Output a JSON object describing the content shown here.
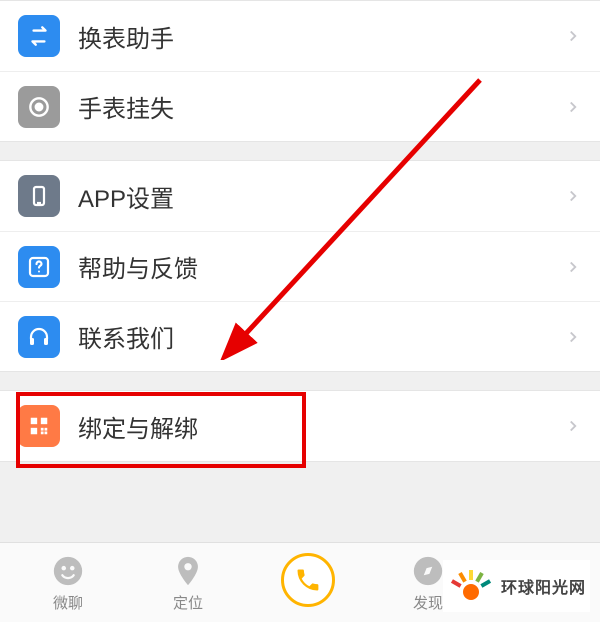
{
  "groups": [
    {
      "items": [
        {
          "name": "row-change-watch",
          "icon_name": "swap-icon",
          "icon_bg": "#2d8cf0",
          "label": "换表助手"
        },
        {
          "name": "row-watch-lost",
          "icon_name": "target-icon",
          "icon_bg": "#9b9b9b",
          "label": "手表挂失"
        }
      ]
    },
    {
      "items": [
        {
          "name": "row-app-settings",
          "icon_name": "phone-icon",
          "icon_bg": "#6e7a8a",
          "label": "APP设置"
        },
        {
          "name": "row-help-feedback",
          "icon_name": "question-icon",
          "icon_bg": "#2d8cf0",
          "label": "帮助与反馈"
        },
        {
          "name": "row-contact-us",
          "icon_name": "headset-icon",
          "icon_bg": "#2d8cf0",
          "label": "联系我们"
        }
      ]
    },
    {
      "items": [
        {
          "name": "row-bind-unbind",
          "icon_name": "qr-icon",
          "icon_bg": "#ff7a45",
          "label": "绑定与解绑"
        }
      ]
    }
  ],
  "tabs": [
    {
      "name": "tab-chat",
      "icon_name": "chat-icon",
      "label": "微聊",
      "active": false
    },
    {
      "name": "tab-location",
      "icon_name": "location-icon",
      "label": "定位",
      "active": false
    },
    {
      "name": "tab-call",
      "icon_name": "call-icon",
      "label": "",
      "active": true
    },
    {
      "name": "tab-discover",
      "icon_name": "compass-icon",
      "label": "发现",
      "active": false
    }
  ],
  "watermark": {
    "text": "环球阳光网"
  },
  "annotation": {
    "highlighted_item": "绑定与解绑",
    "colors": {
      "arrow": "#e60000",
      "box": "#e60000"
    }
  }
}
